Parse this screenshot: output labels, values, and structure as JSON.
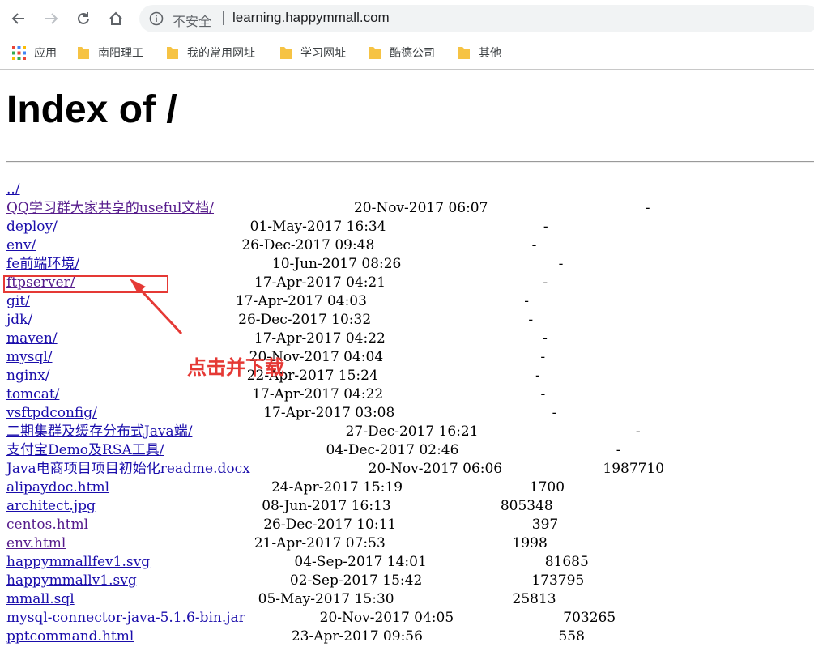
{
  "browser": {
    "security_label": "不安全",
    "separator": "|",
    "url": "learning.happymmall.com",
    "bookmarks": [
      {
        "label": "应用",
        "icon": "apps-grid-icon"
      },
      {
        "label": "南阳理工",
        "icon": "folder-icon"
      },
      {
        "label": "我的常用网址",
        "icon": "folder-icon"
      },
      {
        "label": "学习网址",
        "icon": "folder-icon"
      },
      {
        "label": "酷德公司",
        "icon": "folder-icon"
      },
      {
        "label": "其他",
        "icon": "folder-icon"
      }
    ],
    "colors": {
      "folder": "#f6c344",
      "omnibox": "#f1f3f4",
      "link": "#1a0dab",
      "visited": "#551a8b"
    }
  },
  "page": {
    "title": "Index of /",
    "entries": [
      {
        "name": "../",
        "date": "",
        "size": "",
        "visited": false
      },
      {
        "name": "QQ学习群大家共享的useful文档/",
        "date": "20-Nov-2017 06:07",
        "size": "-",
        "visited": true
      },
      {
        "name": "deploy/",
        "date": "01-May-2017 16:34",
        "size": "-",
        "visited": false
      },
      {
        "name": "env/",
        "date": "26-Dec-2017 09:48",
        "size": "-",
        "visited": false
      },
      {
        "name": "fe前端环境/",
        "date": "10-Jun-2017 08:26",
        "size": "-",
        "visited": false
      },
      {
        "name": "ftpserver/",
        "date": "17-Apr-2017 04:21",
        "size": "-",
        "visited": true
      },
      {
        "name": "git/",
        "date": "17-Apr-2017 04:03",
        "size": "-",
        "visited": false
      },
      {
        "name": "jdk/",
        "date": "26-Dec-2017 10:32",
        "size": "-",
        "visited": false
      },
      {
        "name": "maven/",
        "date": "17-Apr-2017 04:22",
        "size": "-",
        "visited": false
      },
      {
        "name": "mysql/",
        "date": "20-Nov-2017 04:04",
        "size": "-",
        "visited": false
      },
      {
        "name": "nginx/",
        "date": "22-Apr-2017 15:24",
        "size": "-",
        "visited": false
      },
      {
        "name": "tomcat/",
        "date": "17-Apr-2017 04:22",
        "size": "-",
        "visited": false
      },
      {
        "name": "vsftpdconfig/",
        "date": "17-Apr-2017 03:08",
        "size": "-",
        "visited": false
      },
      {
        "name": "二期集群及缓存分布式Java端/",
        "date": "27-Dec-2017 16:21",
        "size": "-",
        "visited": false
      },
      {
        "name": "支付宝Demo及RSA工具/",
        "date": "04-Dec-2017 02:46",
        "size": "-",
        "visited": false
      },
      {
        "name": "Java电商项目项目初始化readme.docx",
        "date": "20-Nov-2017 06:06",
        "size": "1987710",
        "visited": false
      },
      {
        "name": "alipaydoc.html",
        "date": "24-Apr-2017 15:19",
        "size": "1700",
        "visited": false
      },
      {
        "name": "architect.jpg",
        "date": "08-Jun-2017 16:13",
        "size": "805348",
        "visited": false
      },
      {
        "name": "centos.html",
        "date": "26-Dec-2017 10:11",
        "size": "397",
        "visited": true
      },
      {
        "name": "env.html",
        "date": "21-Apr-2017 07:53",
        "size": "1998",
        "visited": true
      },
      {
        "name": "happymmallfev1.svg",
        "date": "04-Sep-2017 14:01",
        "size": "81685",
        "visited": false
      },
      {
        "name": "happymmallv1.svg",
        "date": "02-Sep-2017 15:42",
        "size": "173795",
        "visited": false
      },
      {
        "name": "mmall.sql",
        "date": "05-May-2017 15:30",
        "size": "25813",
        "visited": false
      },
      {
        "name": "mysql-connector-java-5.1.6-bin.jar",
        "date": "20-Nov-2017 04:05",
        "size": "703265",
        "visited": false
      },
      {
        "name": "pptcommand.html",
        "date": "23-Apr-2017 09:56",
        "size": "558",
        "visited": false
      }
    ]
  },
  "annotation": {
    "text": "点击并下载",
    "color": "#e53935"
  }
}
